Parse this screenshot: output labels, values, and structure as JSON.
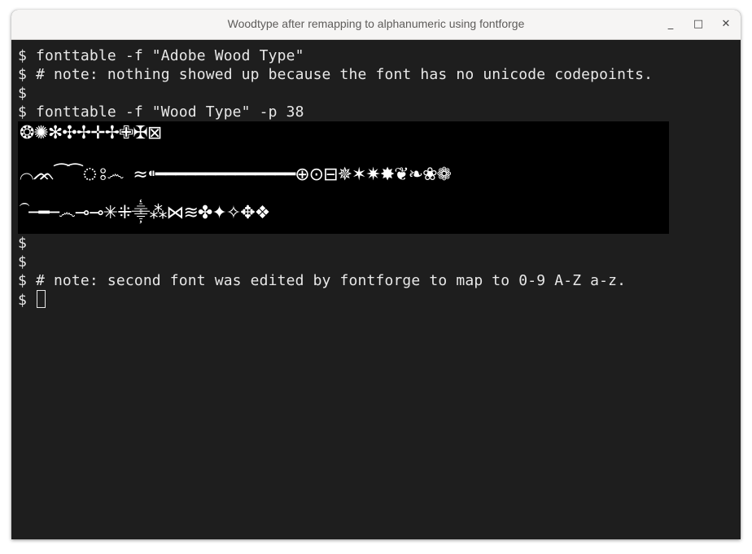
{
  "window": {
    "title": "Woodtype after remapping to alphanumeric using fontforge",
    "controls": {
      "minimize": "_",
      "maximize": "□",
      "close": "✕"
    }
  },
  "terminal": {
    "lines_before": [
      "$ fonttable -f \"Adobe Wood Type\"",
      "$ # note: nothing showed up because the font has no unicode codepoints.",
      "$",
      "$ fonttable -f \"Wood Type\" -p 38"
    ],
    "glyph_rows": [
      "❂✺✻✣✢✛✢✙✠⊠",
      "⌒ᨏ⁀⁀ঃ෴  ≈⁌━━━━━━━━━━━━━━⊕⊙⊟✵✶✷✸❦❧❀❁",
      "⏜─━─෴⊸⊸✳⁜⸎⁂⋈≋✤✦✧✥❖"
    ],
    "lines_after": [
      "$",
      "$",
      "$ # note: second font was edited by fontforge to map to 0-9 A-Z a-z.",
      "$ "
    ]
  }
}
